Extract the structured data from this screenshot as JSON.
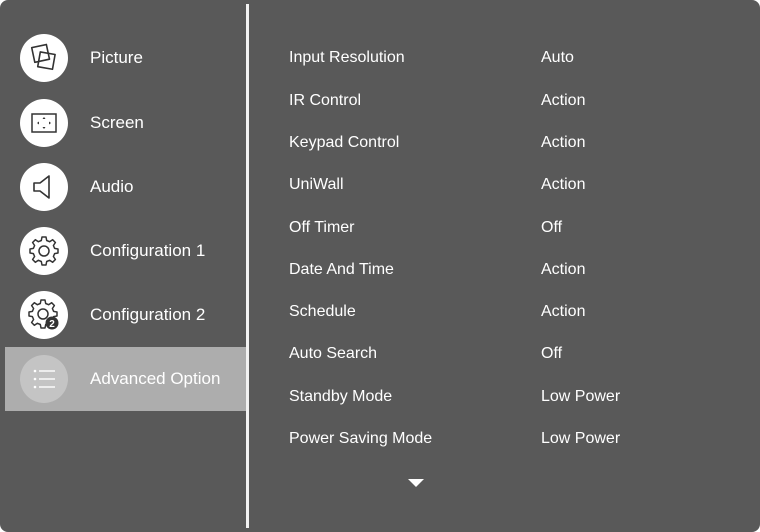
{
  "sidebar": {
    "items": [
      {
        "label": "Picture",
        "icon": "picture-icon",
        "selected": false
      },
      {
        "label": "Screen",
        "icon": "screen-icon",
        "selected": false
      },
      {
        "label": "Audio",
        "icon": "speaker-icon",
        "selected": false
      },
      {
        "label": "Configuration 1",
        "icon": "gear-icon",
        "selected": false
      },
      {
        "label": "Configuration 2",
        "icon": "gear-2-icon",
        "selected": false
      },
      {
        "label": "Advanced Option",
        "icon": "list-icon",
        "selected": true
      }
    ],
    "gear2_badge": "2"
  },
  "options": [
    {
      "label": "Input Resolution",
      "value": "Auto"
    },
    {
      "label": "IR Control",
      "value": "Action"
    },
    {
      "label": "Keypad Control",
      "value": "Action"
    },
    {
      "label": "UniWall",
      "value": "Action"
    },
    {
      "label": "Off Timer",
      "value": "Off"
    },
    {
      "label": "Date And Time",
      "value": "Action"
    },
    {
      "label": "Schedule",
      "value": "Action"
    },
    {
      "label": "Auto Search",
      "value": "Off"
    },
    {
      "label": "Standby Mode",
      "value": "Low Power"
    },
    {
      "label": "Power Saving Mode",
      "value": "Low Power"
    }
  ],
  "more_indicator": "down-arrow-icon",
  "colors": {
    "background": "#595959",
    "selected": "#adadad",
    "text": "#ffffff",
    "divider": "#f2f2f2"
  }
}
